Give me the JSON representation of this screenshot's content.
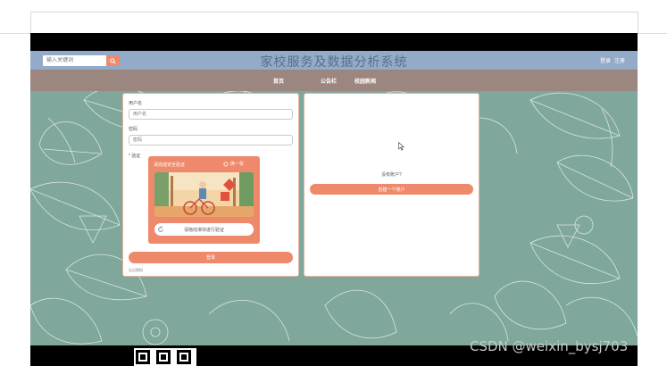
{
  "header": {
    "title": "家校服务及数据分析系统",
    "search_placeholder": "输入关键词",
    "search_icon": "search-icon",
    "login_link": "登录",
    "register_link": "注册"
  },
  "nav": {
    "items": [
      {
        "label": "首页"
      },
      {
        "label": "公告栏"
      },
      {
        "label": "校园新闻"
      }
    ]
  },
  "login_form": {
    "username_label": "用户名",
    "username_placeholder": "用户名",
    "password_label": "密码",
    "password_placeholder": "密码",
    "captcha_label": "* 验证",
    "captcha_title": "请完成安全验证",
    "captcha_refresh": "换一张",
    "captcha_slider_text": "请拖动滑块进行验证",
    "submit_label": "登录",
    "forgot_label": "忘记密码"
  },
  "register_panel": {
    "prompt": "没有账户?",
    "create_label": "创建一个账户"
  },
  "watermark": "CSDN @weixin_bysj703",
  "colors": {
    "header_bg": "#93aac9",
    "nav_bg": "#9b8680",
    "accent": "#ee8a6b",
    "background": "#7fa79c"
  }
}
